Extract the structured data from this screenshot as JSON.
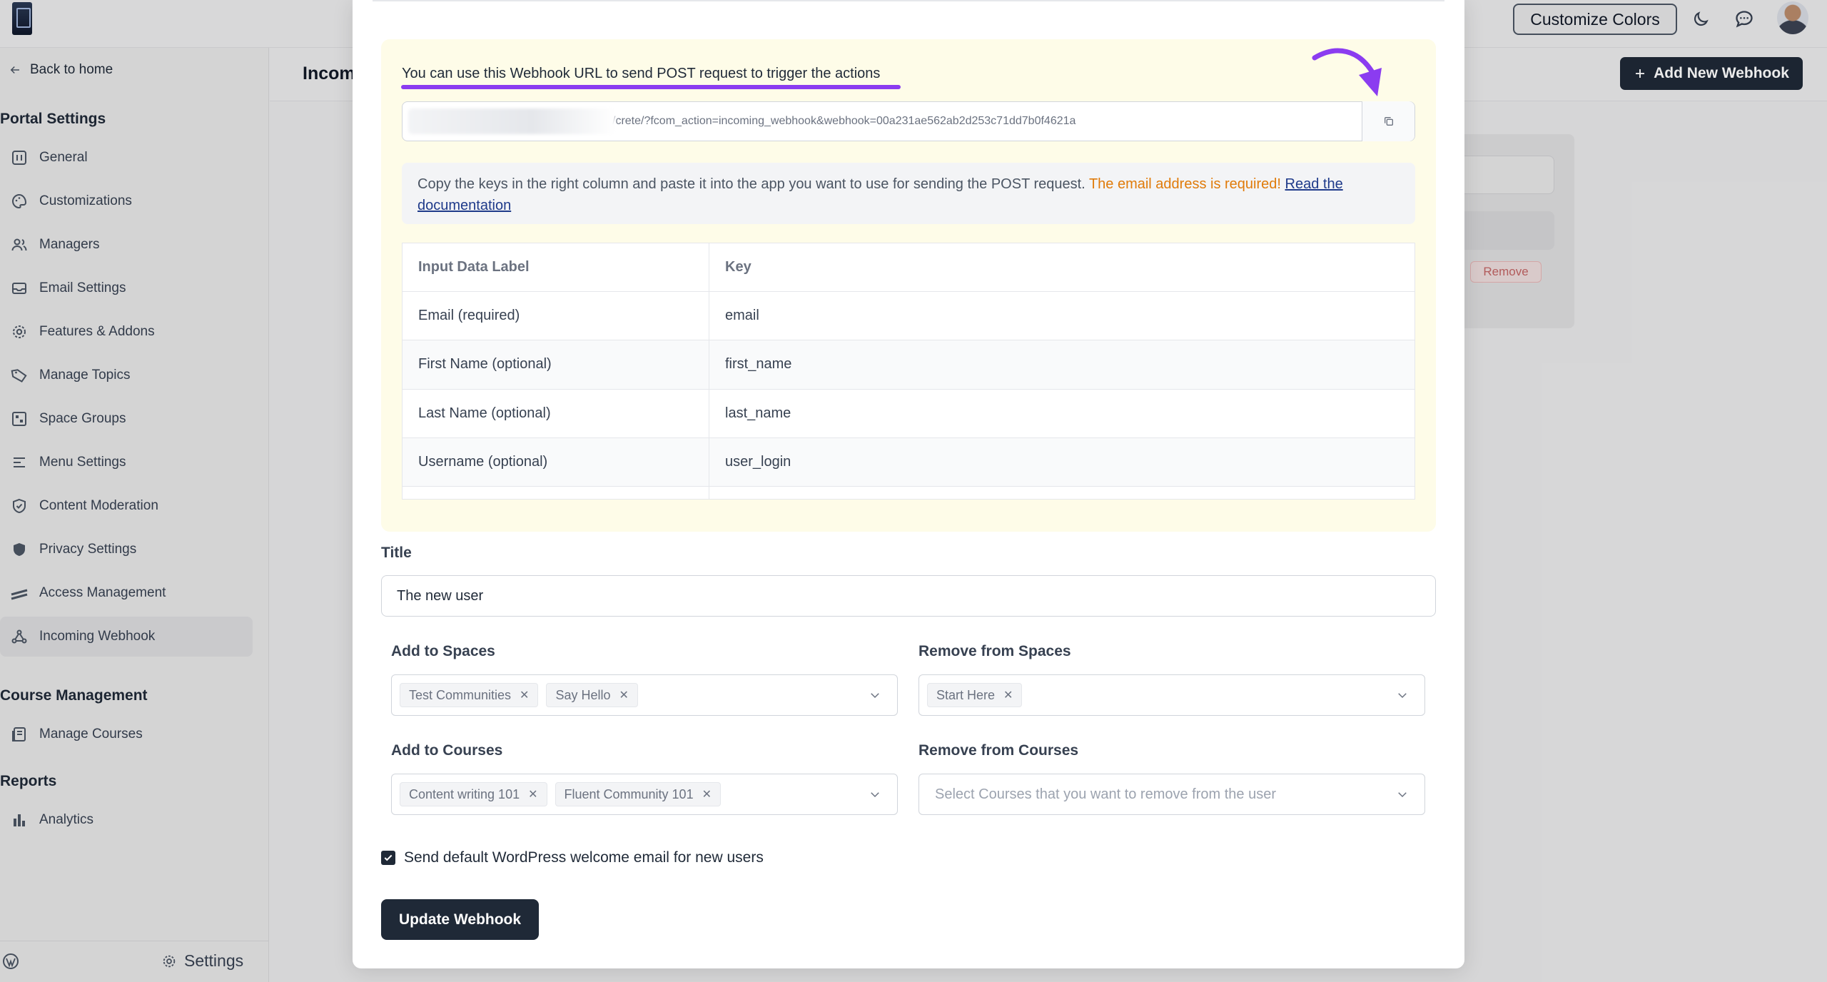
{
  "topbar": {
    "customize_label": "Customize Colors",
    "icons": [
      "moon-icon",
      "chat-icon",
      "avatar"
    ]
  },
  "sidebar": {
    "back_label": "Back to home",
    "sections": {
      "portal": "Portal Settings",
      "course": "Course Management",
      "reports": "Reports"
    },
    "portal_items": [
      {
        "label": "General",
        "icon": "general-icon"
      },
      {
        "label": "Customizations",
        "icon": "palette-icon"
      },
      {
        "label": "Managers",
        "icon": "users-icon"
      },
      {
        "label": "Email Settings",
        "icon": "mail-icon"
      },
      {
        "label": "Features & Addons",
        "icon": "gear-icon"
      },
      {
        "label": "Manage Topics",
        "icon": "tag-icon"
      },
      {
        "label": "Space Groups",
        "icon": "grid-icon"
      },
      {
        "label": "Menu Settings",
        "icon": "menu-icon"
      },
      {
        "label": "Content Moderation",
        "icon": "shield-check-icon"
      },
      {
        "label": "Privacy Settings",
        "icon": "shield-icon"
      },
      {
        "label": "Access Management",
        "icon": "access-icon"
      },
      {
        "label": "Incoming Webhook",
        "icon": "webhook-icon",
        "active": true
      }
    ],
    "course_items": [
      {
        "label": "Manage Courses",
        "icon": "courses-icon"
      }
    ],
    "report_items": [
      {
        "label": "Analytics",
        "icon": "chart-icon"
      }
    ],
    "settings_label": "Settings"
  },
  "page": {
    "title": "Incom",
    "add_button": "Add New Webhook",
    "remove_label": "Remove"
  },
  "modal": {
    "info_title": "You can use this Webhook URL to send POST request to trigger the actions",
    "url_value": "/crete/?fcom_action=incoming_webhook&webhook=00a231ae562ab2d253c71dd7b0f4621a",
    "note_text": "Copy the keys in the right column and paste it into the app you want to use for sending the POST request. ",
    "note_warning": "The email address is required!",
    "note_link": "Read the documentation",
    "table": {
      "headers": [
        "Input Data Label",
        "Key"
      ],
      "rows": [
        [
          "Email (required)",
          "email"
        ],
        [
          "First Name (optional)",
          "first_name"
        ],
        [
          "Last Name (optional)",
          "last_name"
        ],
        [
          "Username (optional)",
          "user_login"
        ]
      ]
    },
    "title_label": "Title",
    "title_value": "The new user",
    "add_spaces_label": "Add to Spaces",
    "add_spaces_selected": [
      "Test Communities",
      "Say Hello"
    ],
    "remove_spaces_label": "Remove from Spaces",
    "remove_spaces_selected": [
      "Start Here"
    ],
    "add_courses_label": "Add to Courses",
    "add_courses_selected": [
      "Content writing 101",
      "Fluent Community 101"
    ],
    "remove_courses_label": "Remove from Courses",
    "remove_courses_placeholder": "Select Courses that you want to remove from the user",
    "checkbox_label": "Send default WordPress welcome email for new users",
    "checkbox_checked": true,
    "submit_label": "Update Webhook"
  },
  "colors": {
    "annotation": "#8b3cf0",
    "warning": "#e07b0a",
    "primary_dark": "#1f2937",
    "info_background": "#fefce8"
  }
}
